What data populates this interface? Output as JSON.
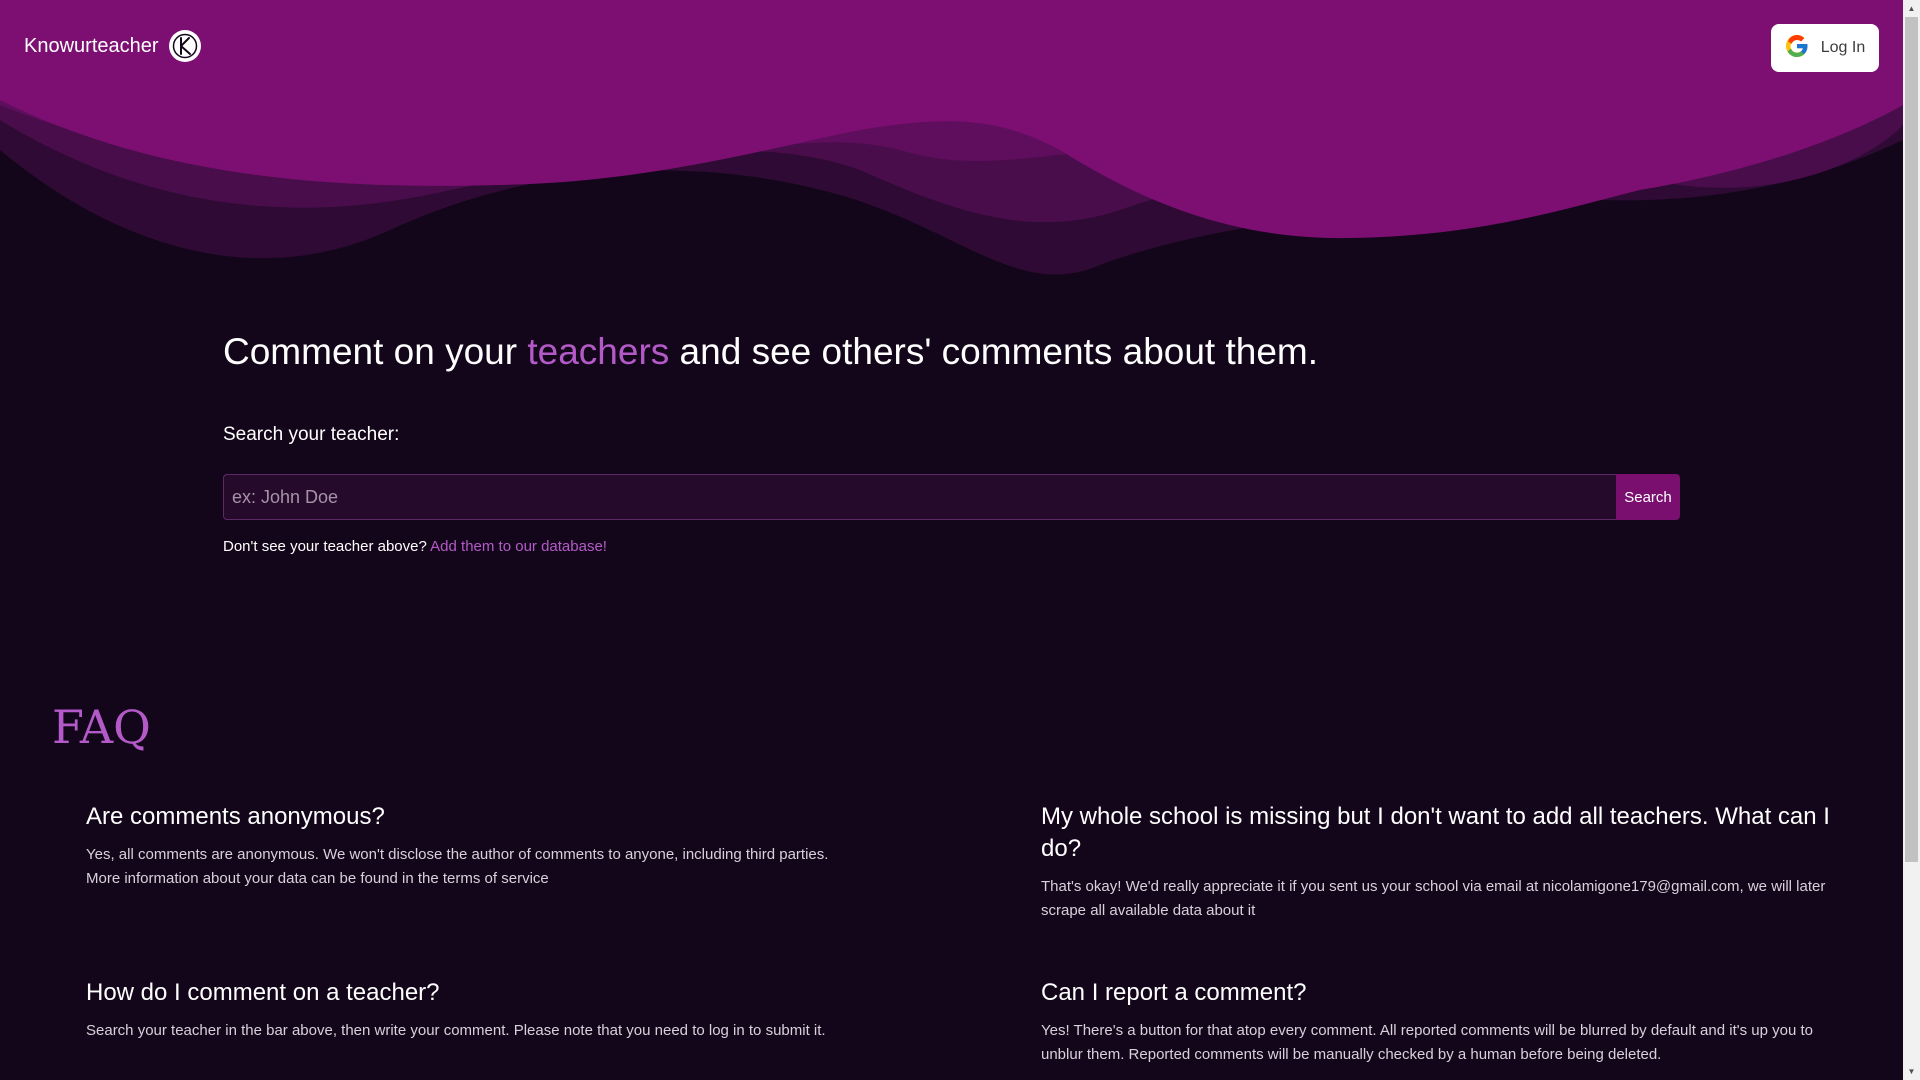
{
  "header": {
    "brand_name": "Knowurteacher",
    "logo_icon": "knowurteacher-logo-icon",
    "login": {
      "label": "Log In",
      "icon": "google-icon"
    }
  },
  "hero": {
    "title_before": "Comment on your ",
    "title_accent": "teachers",
    "title_after": " and see others' comments about them.",
    "search_label": "Search your teacher:",
    "search_placeholder": "ex: John Doe",
    "search_value": "",
    "search_button": "Search",
    "db_note": "Don't see your teacher above?",
    "db_link": "Add them to our database!"
  },
  "faq": {
    "title": "FAQ",
    "items": [
      {
        "question": "Are comments anonymous?",
        "answer": "Yes, all comments are anonymous. We won't disclose the author of comments to anyone, including third parties. More information about your data can be found in the terms of service"
      },
      {
        "question": "My whole school is missing but I don't want to add all teachers. What can I do?",
        "answer": "That's okay! We'd really appreciate it if you sent us your school via email at nicolamigone179@gmail.com, we will later scrape all available data about it"
      },
      {
        "question": "How do I comment on a teacher?",
        "answer": "Search your teacher in the bar above, then write your comment. Please note that you need to log in to submit it."
      },
      {
        "question": "Can I report a comment?",
        "answer": "Yes! There's a button for that atop every comment. All reported comments will be blurred by default and it's up you to unblur them. Reported comments will be manually checked by a human before being deleted."
      }
    ]
  },
  "colors": {
    "background": "#13061a",
    "header_purple": "#7d0f73",
    "accent": "#b45ac8",
    "search_button": "#7a0f70",
    "input_background": "#260a2c"
  }
}
